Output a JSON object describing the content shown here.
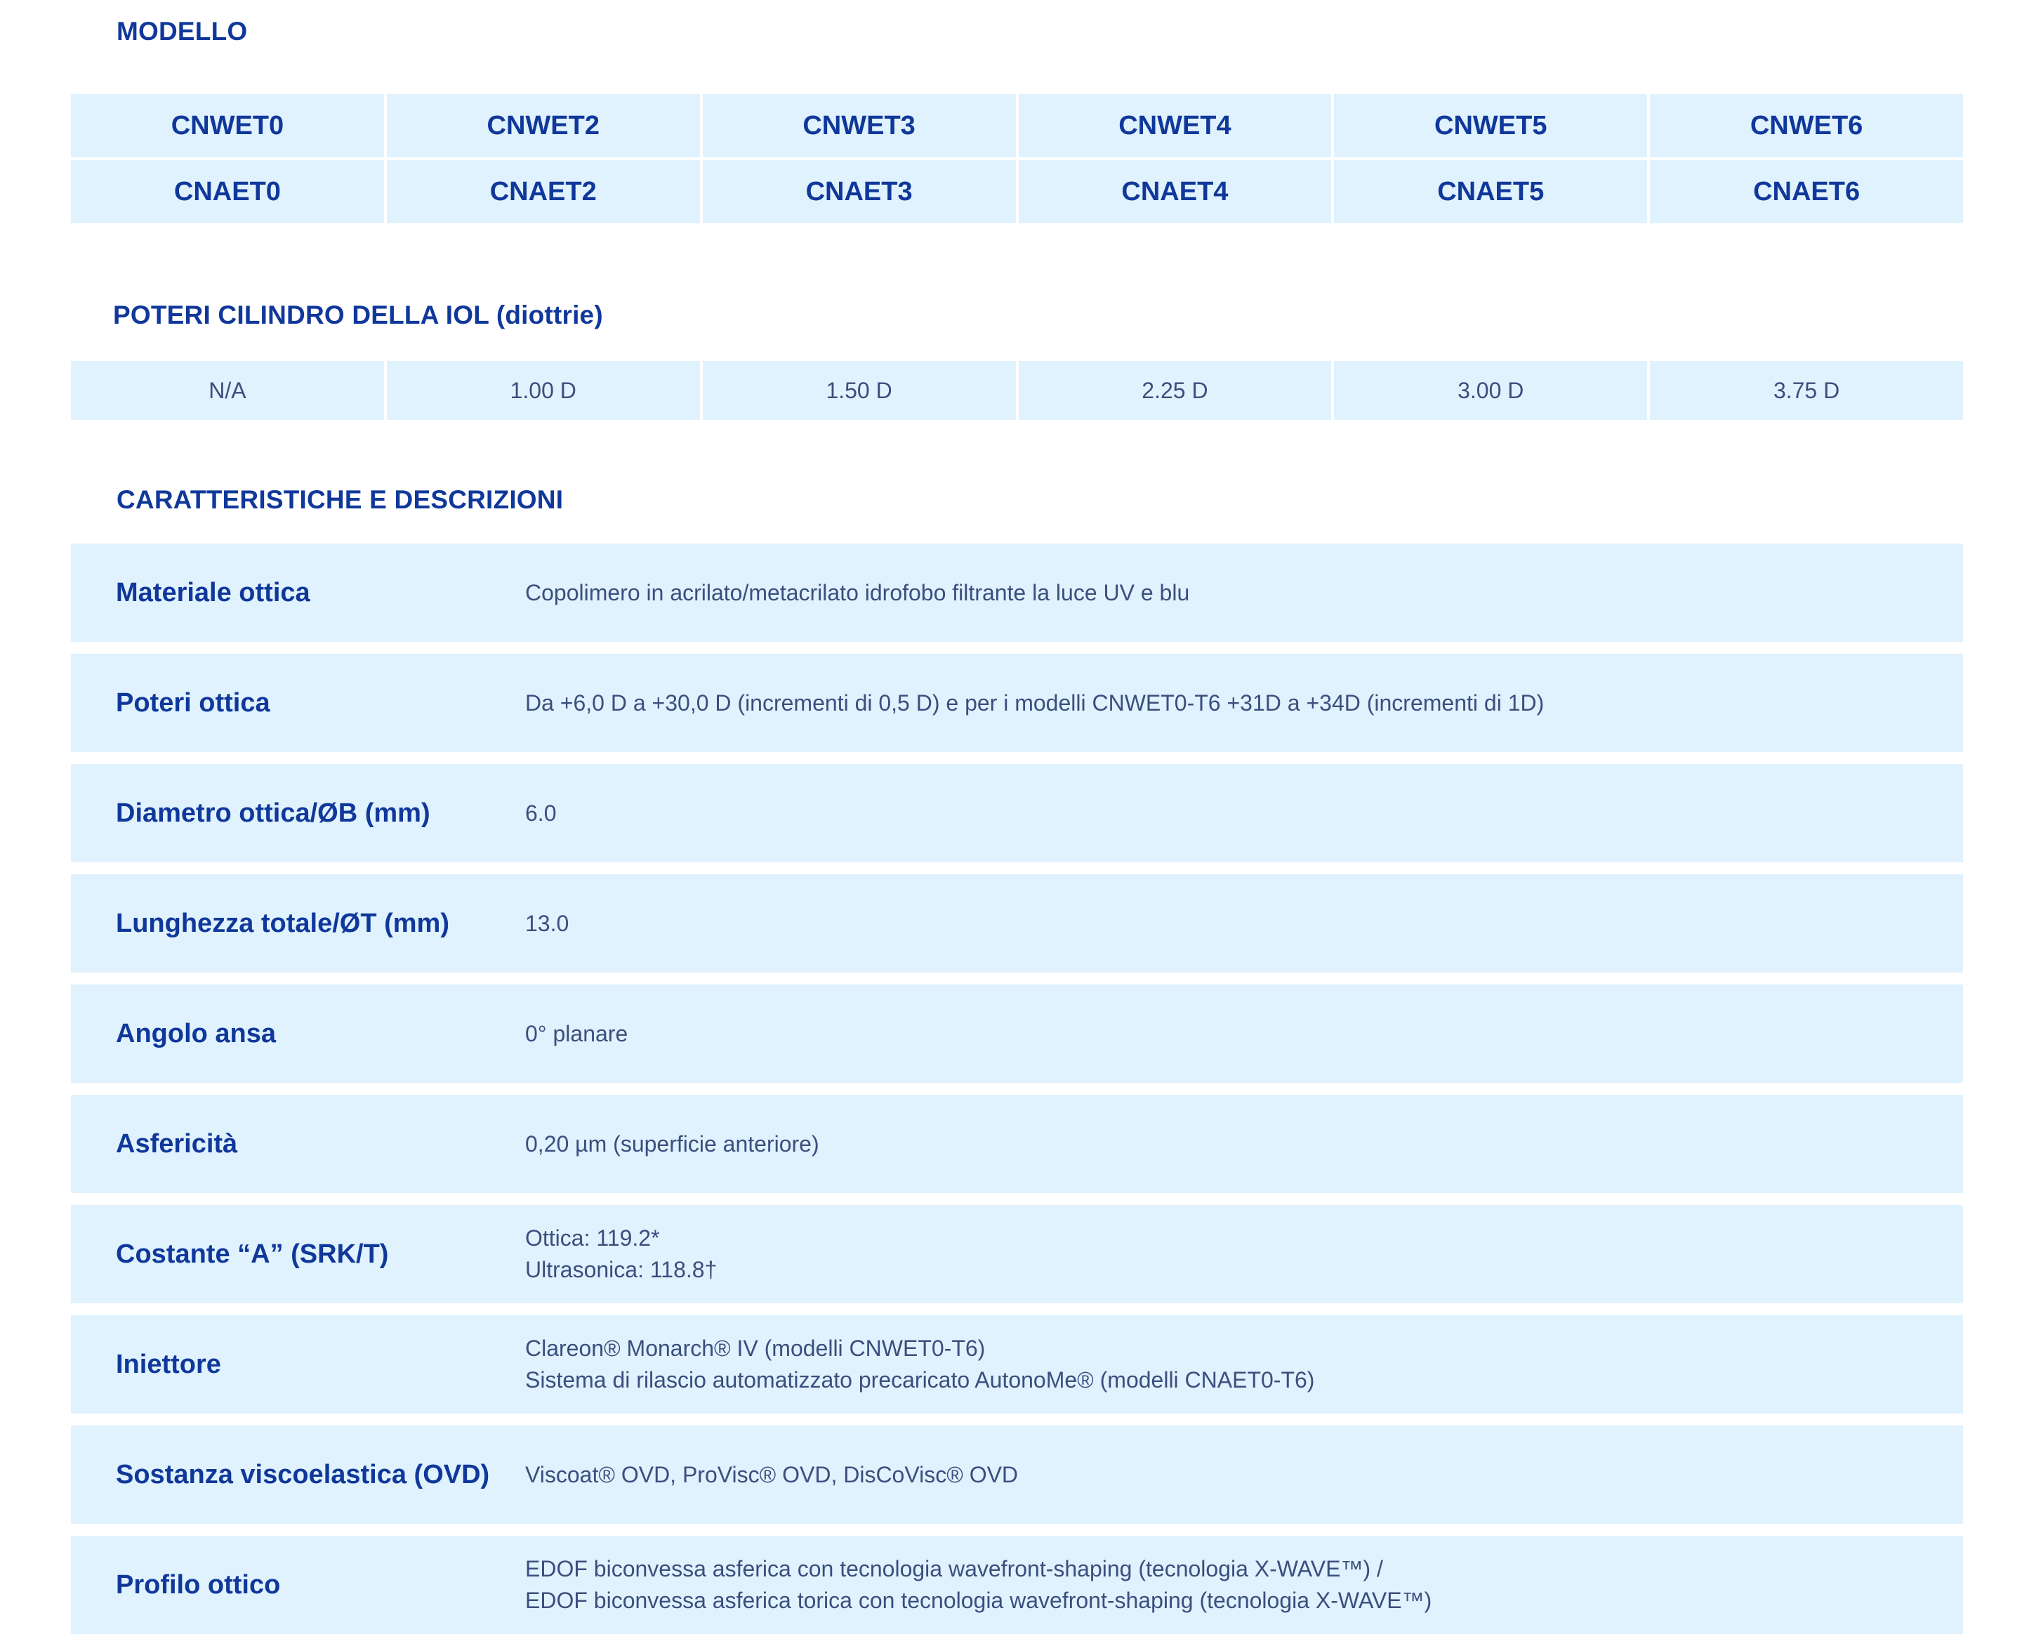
{
  "sections": {
    "modello_title": "MODELLO",
    "poteri_title": "POTERI CILINDRO DELLA IOL (diottrie)",
    "caratteristiche_title": "CARATTERISTICHE E DESCRIZIONI"
  },
  "models": {
    "row1": [
      "CNWET0",
      "CNWET2",
      "CNWET3",
      "CNWET4",
      "CNWET5",
      "CNWET6"
    ],
    "row2": [
      "CNAET0",
      "CNAET2",
      "CNAET3",
      "CNAET4",
      "CNAET5",
      "CNAET6"
    ]
  },
  "cylinder_powers": [
    "N/A",
    "1.00 D",
    "1.50 D",
    "2.25 D",
    "3.00 D",
    "3.75 D"
  ],
  "features": [
    {
      "label": "Materiale ottica",
      "lines": [
        "Copolimero in acrilato/metacrilato idrofobo filtrante la luce UV e blu"
      ]
    },
    {
      "label": "Poteri ottica",
      "lines": [
        "Da +6,0 D a +30,0 D (incrementi di 0,5 D) e per i modelli CNWET0-T6 +31D a +34D (incrementi di 1D)"
      ]
    },
    {
      "label": "Diametro ottica/ØB (mm)",
      "lines": [
        "6.0"
      ]
    },
    {
      "label": "Lunghezza totale/ØT (mm)",
      "lines": [
        "13.0"
      ]
    },
    {
      "label": "Angolo ansa",
      "lines": [
        "0° planare"
      ]
    },
    {
      "label": "Asfericità",
      "lines": [
        "0,20 µm (superficie anteriore)"
      ]
    },
    {
      "label": "Costante “A” (SRK/T)",
      "lines": [
        "Ottica: 119.2*",
        "Ultrasonica: 118.8†"
      ]
    },
    {
      "label": "Iniettore",
      "lines": [
        "Clareon® Monarch® IV (modelli CNWET0-T6)",
        "Sistema di rilascio automatizzato precaricato AutonoMe® (modelli CNAET0-T6)"
      ]
    },
    {
      "label": "Sostanza viscoelastica (OVD)",
      "lines": [
        "Viscoat® OVD, ProVisc® OVD, DisCoVisc® OVD"
      ]
    },
    {
      "label": "Profilo ottico",
      "lines": [
        "EDOF biconvessa asferica con tecnologia wavefront-shaping (tecnologia X-WAVE™) /",
        "EDOF biconvessa asferica torica con tecnologia wavefront-shaping (tecnologia X-WAVE™)"
      ]
    }
  ]
}
